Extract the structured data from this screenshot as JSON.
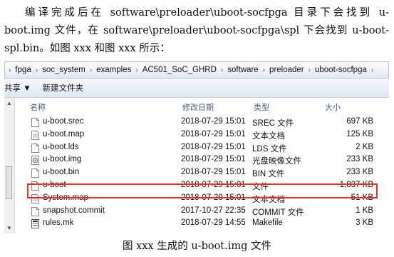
{
  "paragraph": "编译完成后在 software\\preloader\\uboot-socfpga 目录下会找到 u-boot.img 文件，在 software\\preloader\\uboot-socfpga\\spl 下会找到 u-boot- spl.bin。如图 xxx 和图 xxx 所示：",
  "breadcrumb": {
    "lead": "›",
    "segments": [
      "fpga",
      "soc_system",
      "examples",
      "AC501_SoC_GHRD",
      "software",
      "preloader",
      "uboot-socfpga"
    ],
    "separator": "›",
    "trail": "›"
  },
  "toolbar": {
    "share_label": "共享 ▼",
    "new_folder_label": "新建文件夹"
  },
  "columns": {
    "name": "名称",
    "date": "修改日期",
    "type": "类型",
    "size": "大小"
  },
  "files": [
    {
      "name": "u-boot.srec",
      "date": "2018-07-29 15:01",
      "type": "SREC 文件",
      "size": "697 KB",
      "icon": "file-icon"
    },
    {
      "name": "u-boot.map",
      "date": "2018-07-29 15:01",
      "type": "文本文档",
      "size": "125 KB",
      "icon": "text-file-icon"
    },
    {
      "name": "u-boot.lds",
      "date": "2018-07-29 15:01",
      "type": "LDS 文件",
      "size": "2 KB",
      "icon": "file-icon"
    },
    {
      "name": "u-boot.img",
      "date": "2018-07-29 15:01",
      "type": "光盘映像文件",
      "size": "233 KB",
      "icon": "disc-image-icon",
      "highlighted": true
    },
    {
      "name": "u-boot.bin",
      "date": "2018-07-29 15:01",
      "type": "BIN 文件",
      "size": "233 KB",
      "icon": "file-icon"
    },
    {
      "name": "u-boot",
      "date": "2018-07-29 15:01",
      "type": "文件",
      "size": "1,837 KB",
      "icon": "file-icon"
    },
    {
      "name": "System.map",
      "date": "2018-07-29 15:01",
      "type": "文本文档",
      "size": "51 KB",
      "icon": "text-file-icon"
    },
    {
      "name": "snapshot.commit",
      "date": "2017-10-27 22:35",
      "type": "COMMIT 文件",
      "size": "1 KB",
      "icon": "file-icon"
    },
    {
      "name": "rules.mk",
      "date": "2018-07-29 14:55",
      "type": "Makefile",
      "size": "3 KB",
      "icon": "makefile-icon"
    }
  ],
  "highlight_color": "#e03232",
  "caption": "图 xxx  生成的 u-boot.img 文件"
}
